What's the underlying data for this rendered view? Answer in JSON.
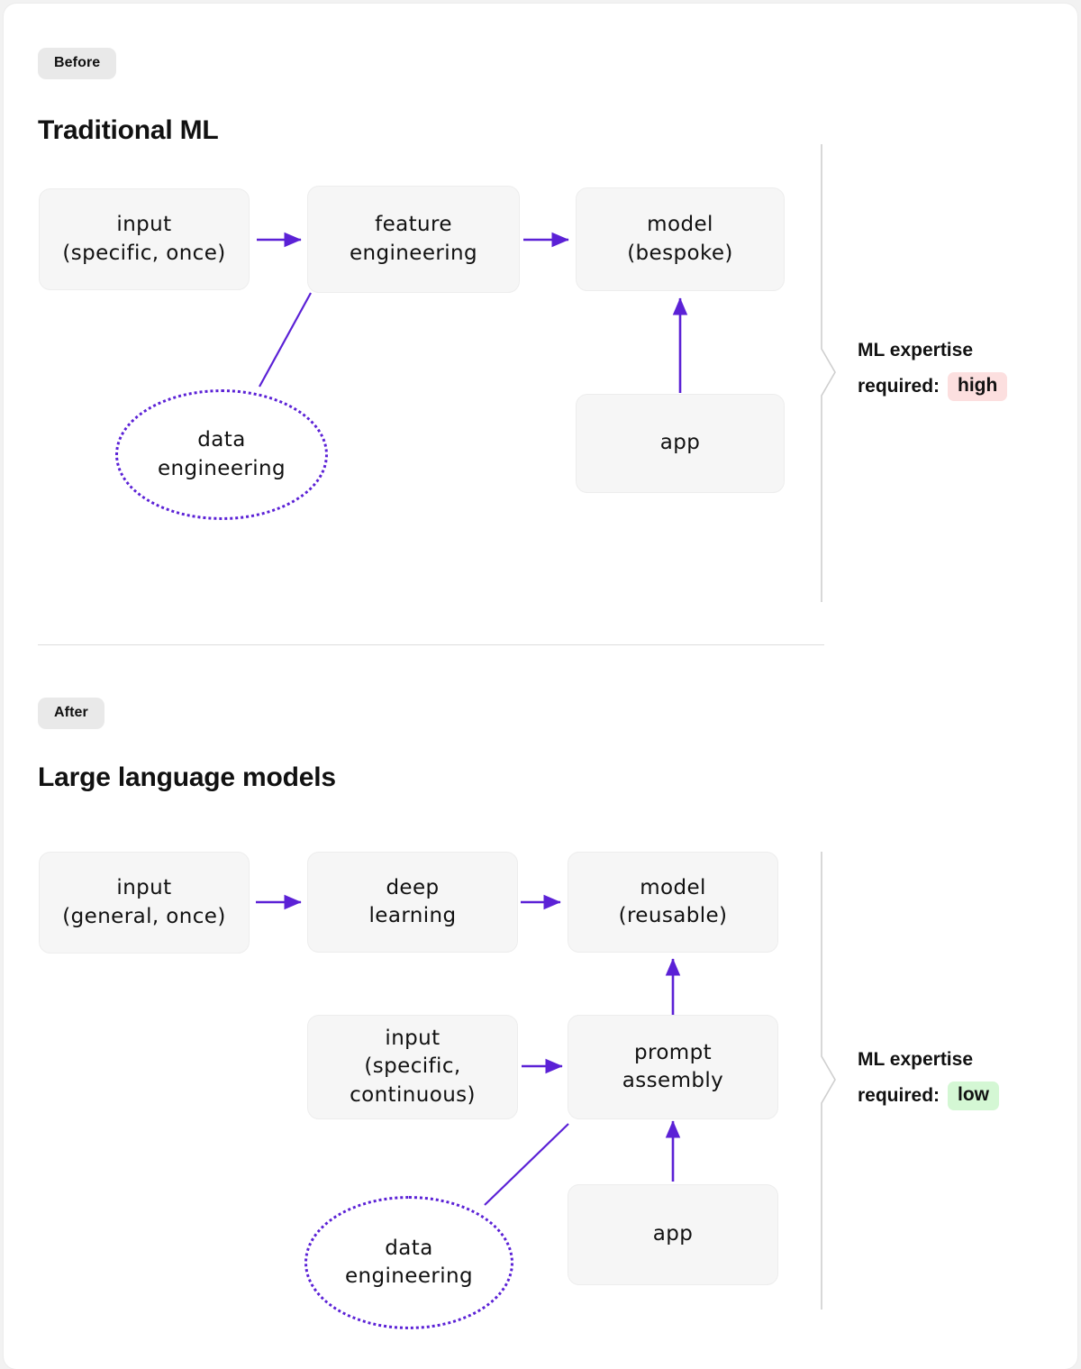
{
  "theme": {
    "page_bg": "#f2f2f2",
    "card_bg": "#ffffff",
    "node_bg": "#f6f6f6",
    "node_border": "#ededed",
    "accent_purple": "#5b21d6",
    "chip_bg": "#e9e9e9",
    "badge_high_bg": "#fcdfdf",
    "badge_low_bg": "#d4f7d4",
    "divider": "#dddddd",
    "text": "#111111"
  },
  "sections": [
    {
      "chip": "Before",
      "title": "Traditional ML",
      "nodes": {
        "input": "input\n(specific, once)",
        "process": "feature\nengineering",
        "model": "model\n(bespoke)",
        "app": "app",
        "data_engineering": "data\nengineering"
      },
      "callout": {
        "line1": "ML expertise",
        "line2_label": "required:",
        "badge": "high"
      }
    },
    {
      "chip": "After",
      "title": "Large language models",
      "nodes": {
        "input": "input\n(general, once)",
        "process": "deep\nlearning",
        "model": "model\n(reusable)",
        "input2": "input\n(specific,\ncontinuous)",
        "prompt": "prompt\nassembly",
        "app": "app",
        "data_engineering": "data\nengineering"
      },
      "callout": {
        "line1": "ML expertise",
        "line2_label": "required:",
        "badge": "low"
      }
    }
  ]
}
